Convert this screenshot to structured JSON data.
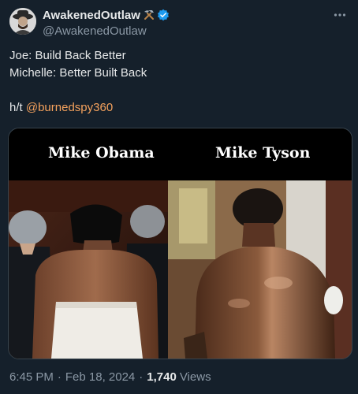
{
  "user": {
    "display_name": "AwakenedOutlaw",
    "name_emoji": "hammer-pick",
    "handle": "@AwakenedOutlaw",
    "verified": true
  },
  "tweet": {
    "line1": "Joe: Build Back Better",
    "line2": "Michelle: Better Built Back",
    "ht_prefix": "h/t ",
    "mention": "@burnedspy360"
  },
  "media": {
    "left_caption": "Mike Obama",
    "right_caption": "Mike Tyson"
  },
  "meta": {
    "time": "6:45 PM",
    "date": "Feb 18, 2024",
    "views_count": "1,740",
    "views_label": "Views",
    "dot": "·"
  },
  "colors": {
    "background": "#15202b",
    "text": "#e7e9ea",
    "secondary": "#8b98a5",
    "mention": "#f5a25d",
    "verified": "#1d9bf0"
  }
}
